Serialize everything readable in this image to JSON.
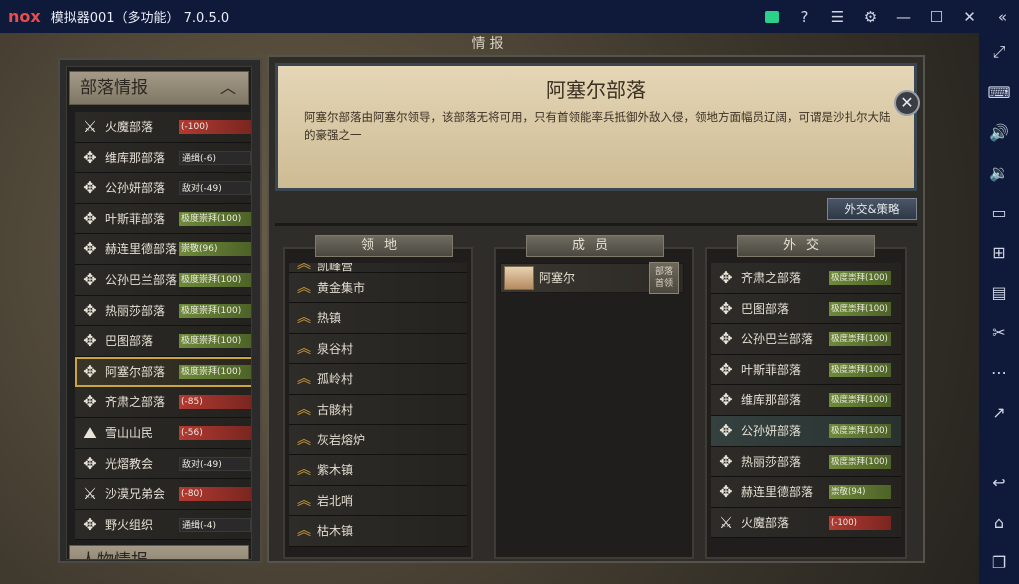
{
  "window": {
    "title": "模拟器001（多功能） 7.0.5.0",
    "logo_text": "nox"
  },
  "header": {
    "title": "情报"
  },
  "left_panel": {
    "section_title": "部落情报",
    "section2_title": "人物情报",
    "tribes": [
      {
        "name": "火魔部落",
        "status": "(-100)",
        "style": "red",
        "icon": "sword-shield-icon"
      },
      {
        "name": "维库那部落",
        "status": "通缉(-6)",
        "style": "dark",
        "icon": "tribe-emblem-icon"
      },
      {
        "name": "公孙妍部落",
        "status": "敌对(-49)",
        "style": "dark",
        "icon": "tribe-emblem-icon"
      },
      {
        "name": "叶斯菲部落",
        "status": "极度崇拜(100)",
        "style": "green",
        "icon": "tribe-emblem-icon"
      },
      {
        "name": "赫连里德部落",
        "status": "崇敬(96)",
        "style": "green",
        "icon": "tribe-emblem-icon"
      },
      {
        "name": "公孙巴兰部落",
        "status": "极度崇拜(100)",
        "style": "green",
        "icon": "tribe-emblem-icon"
      },
      {
        "name": "热丽莎部落",
        "status": "极度崇拜(100)",
        "style": "green",
        "icon": "tribe-emblem-icon"
      },
      {
        "name": "巴图部落",
        "status": "极度崇拜(100)",
        "style": "green",
        "icon": "tribe-emblem-icon"
      },
      {
        "name": "阿塞尔部落",
        "status": "极度崇拜(100)",
        "style": "green",
        "icon": "tribe-emblem-icon",
        "selected": true
      },
      {
        "name": "齐肃之部落",
        "status": "(-85)",
        "style": "red",
        "icon": "tribe-emblem-icon"
      },
      {
        "name": "雪山山民",
        "status": "(-56)",
        "style": "red",
        "icon": "mountain-icon"
      },
      {
        "name": "光熠教会",
        "status": "敌对(-49)",
        "style": "dark",
        "icon": "tribe-emblem-icon"
      },
      {
        "name": "沙漠兄弟会",
        "status": "(-80)",
        "style": "red",
        "icon": "crossed-swords-icon"
      },
      {
        "name": "野火组织",
        "status": "通缉(-4)",
        "style": "dark",
        "icon": "tribe-emblem-icon"
      }
    ]
  },
  "detail": {
    "title": "阿塞尔部落",
    "description": "阿塞尔部落由阿塞尔领导，该部落无将可用，只有首领能率兵抵御外敌入侵，领地方面幅员辽阔，可谓是沙扎尔大陆的豪强之一",
    "diplomacy_button": "外交&策略",
    "close_glyph": "✕"
  },
  "territory": {
    "header": "领地",
    "partial_top": "凯峰营",
    "items": [
      "黄金集市",
      "热镇",
      "泉谷村",
      "孤岭村",
      "古骸村",
      "灰岩熔炉",
      "紫木镇",
      "岩北哨",
      "枯木镇"
    ]
  },
  "members": {
    "header": "成员",
    "items": [
      {
        "name": "阿塞尔",
        "tag_line1": "部落",
        "tag_line2": "首领"
      }
    ]
  },
  "diplomacy": {
    "header": "外交",
    "items": [
      {
        "name": "齐肃之部落",
        "status": "极度崇拜(100)",
        "style": "green",
        "icon": "tribe-emblem-icon"
      },
      {
        "name": "巴图部落",
        "status": "极度崇拜(100)",
        "style": "green",
        "icon": "tribe-emblem-icon"
      },
      {
        "name": "公孙巴兰部落",
        "status": "极度崇拜(100)",
        "style": "green",
        "icon": "tribe-emblem-icon"
      },
      {
        "name": "叶斯菲部落",
        "status": "极度崇拜(100)",
        "style": "green",
        "icon": "tribe-emblem-icon"
      },
      {
        "name": "维库那部落",
        "status": "极度崇拜(100)",
        "style": "green",
        "icon": "tribe-emblem-icon"
      },
      {
        "name": "公孙妍部落",
        "status": "极度崇拜(100)",
        "style": "green",
        "icon": "tribe-emblem-icon",
        "highlight": true
      },
      {
        "name": "热丽莎部落",
        "status": "极度崇拜(100)",
        "style": "green",
        "icon": "tribe-emblem-icon"
      },
      {
        "name": "赫连里德部落",
        "status": "崇敬(94)",
        "style": "green",
        "icon": "tribe-emblem-icon"
      },
      {
        "name": "火魔部落",
        "status": "(-100)",
        "style": "red",
        "icon": "sword-shield-icon"
      }
    ]
  },
  "colors": {
    "accent_gold": "#c9a642",
    "hostile_red": "#b23a32",
    "friendly_green": "#6f8a3c",
    "titlebar_bg": "#0f1a3a"
  }
}
